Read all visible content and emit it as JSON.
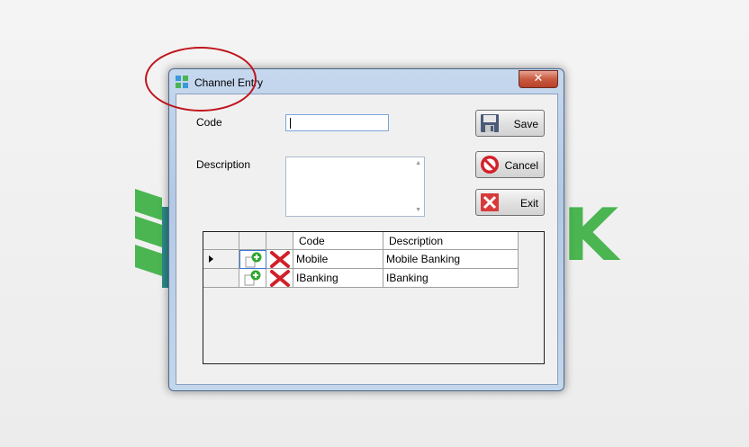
{
  "window": {
    "title": "Channel Entry",
    "close_glyph": "✕"
  },
  "form": {
    "code_label": "Code",
    "code_value": "",
    "description_label": "Description",
    "description_value": ""
  },
  "buttons": {
    "save": "Save",
    "cancel": "Cancel",
    "exit": "Exit"
  },
  "grid": {
    "columns": [
      "Code",
      "Description"
    ],
    "rows": [
      {
        "code": "Mobile",
        "description": "Mobile Banking",
        "selected": true
      },
      {
        "code": "IBanking",
        "description": "IBanking",
        "selected": false
      }
    ]
  },
  "background": {
    "logo_letter": "K"
  },
  "colors": {
    "accent_green": "#4ab551",
    "annotation_red": "#c0141c",
    "close_red": "#c75a40"
  }
}
